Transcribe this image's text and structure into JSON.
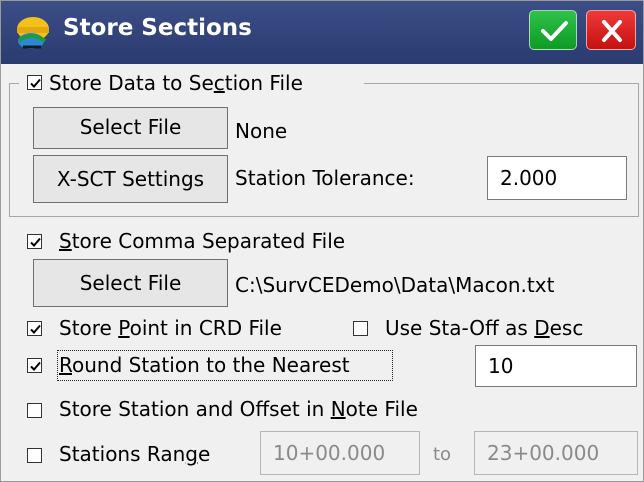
{
  "window": {
    "title": "Store Sections",
    "colors": {
      "titlebar": "#2f4078",
      "ok": "#1bb136",
      "close": "#d81e1e"
    }
  },
  "icons": {
    "app": "surveyor-helmet-icon",
    "ok": "checkmark-icon",
    "close": "close-x-icon"
  },
  "section_file": {
    "checkbox": {
      "label_pre": "Store Data to Se",
      "label_ul": "c",
      "label_post": "tion File",
      "checked": true
    },
    "select_label": "Select File",
    "file_value": "None",
    "xsct_label": "X-SCT Settings",
    "tolerance_label": "Station Tolerance:",
    "tolerance_value": "2.000"
  },
  "comma_file": {
    "checkbox": {
      "label_ul": "S",
      "label_post": "tore Comma Separated File",
      "checked": true
    },
    "select_label": "Select File",
    "file_path": "C:\\SurvCEDemo\\Data\\Macon.txt"
  },
  "point_crd": {
    "label_pre": "Store ",
    "label_ul": "P",
    "label_post": "oint in CRD File",
    "checked": true
  },
  "sta_off": {
    "label_pre": "Use Sta-Off as ",
    "label_ul": "D",
    "label_post": "esc",
    "checked": false
  },
  "round_station": {
    "label_ul": "R",
    "label_post": "ound Station to the Nearest",
    "checked": true,
    "value": "10"
  },
  "note_file": {
    "label_pre": "Store Station and Offset in ",
    "label_ul": "N",
    "label_post": "ote File",
    "checked": false
  },
  "stations_range": {
    "label_pre": "Stations Ran",
    "label_ul": "g",
    "label_post": "e",
    "checked": false,
    "from": "10+00.000",
    "to_label": "to",
    "to": "23+00.000"
  }
}
